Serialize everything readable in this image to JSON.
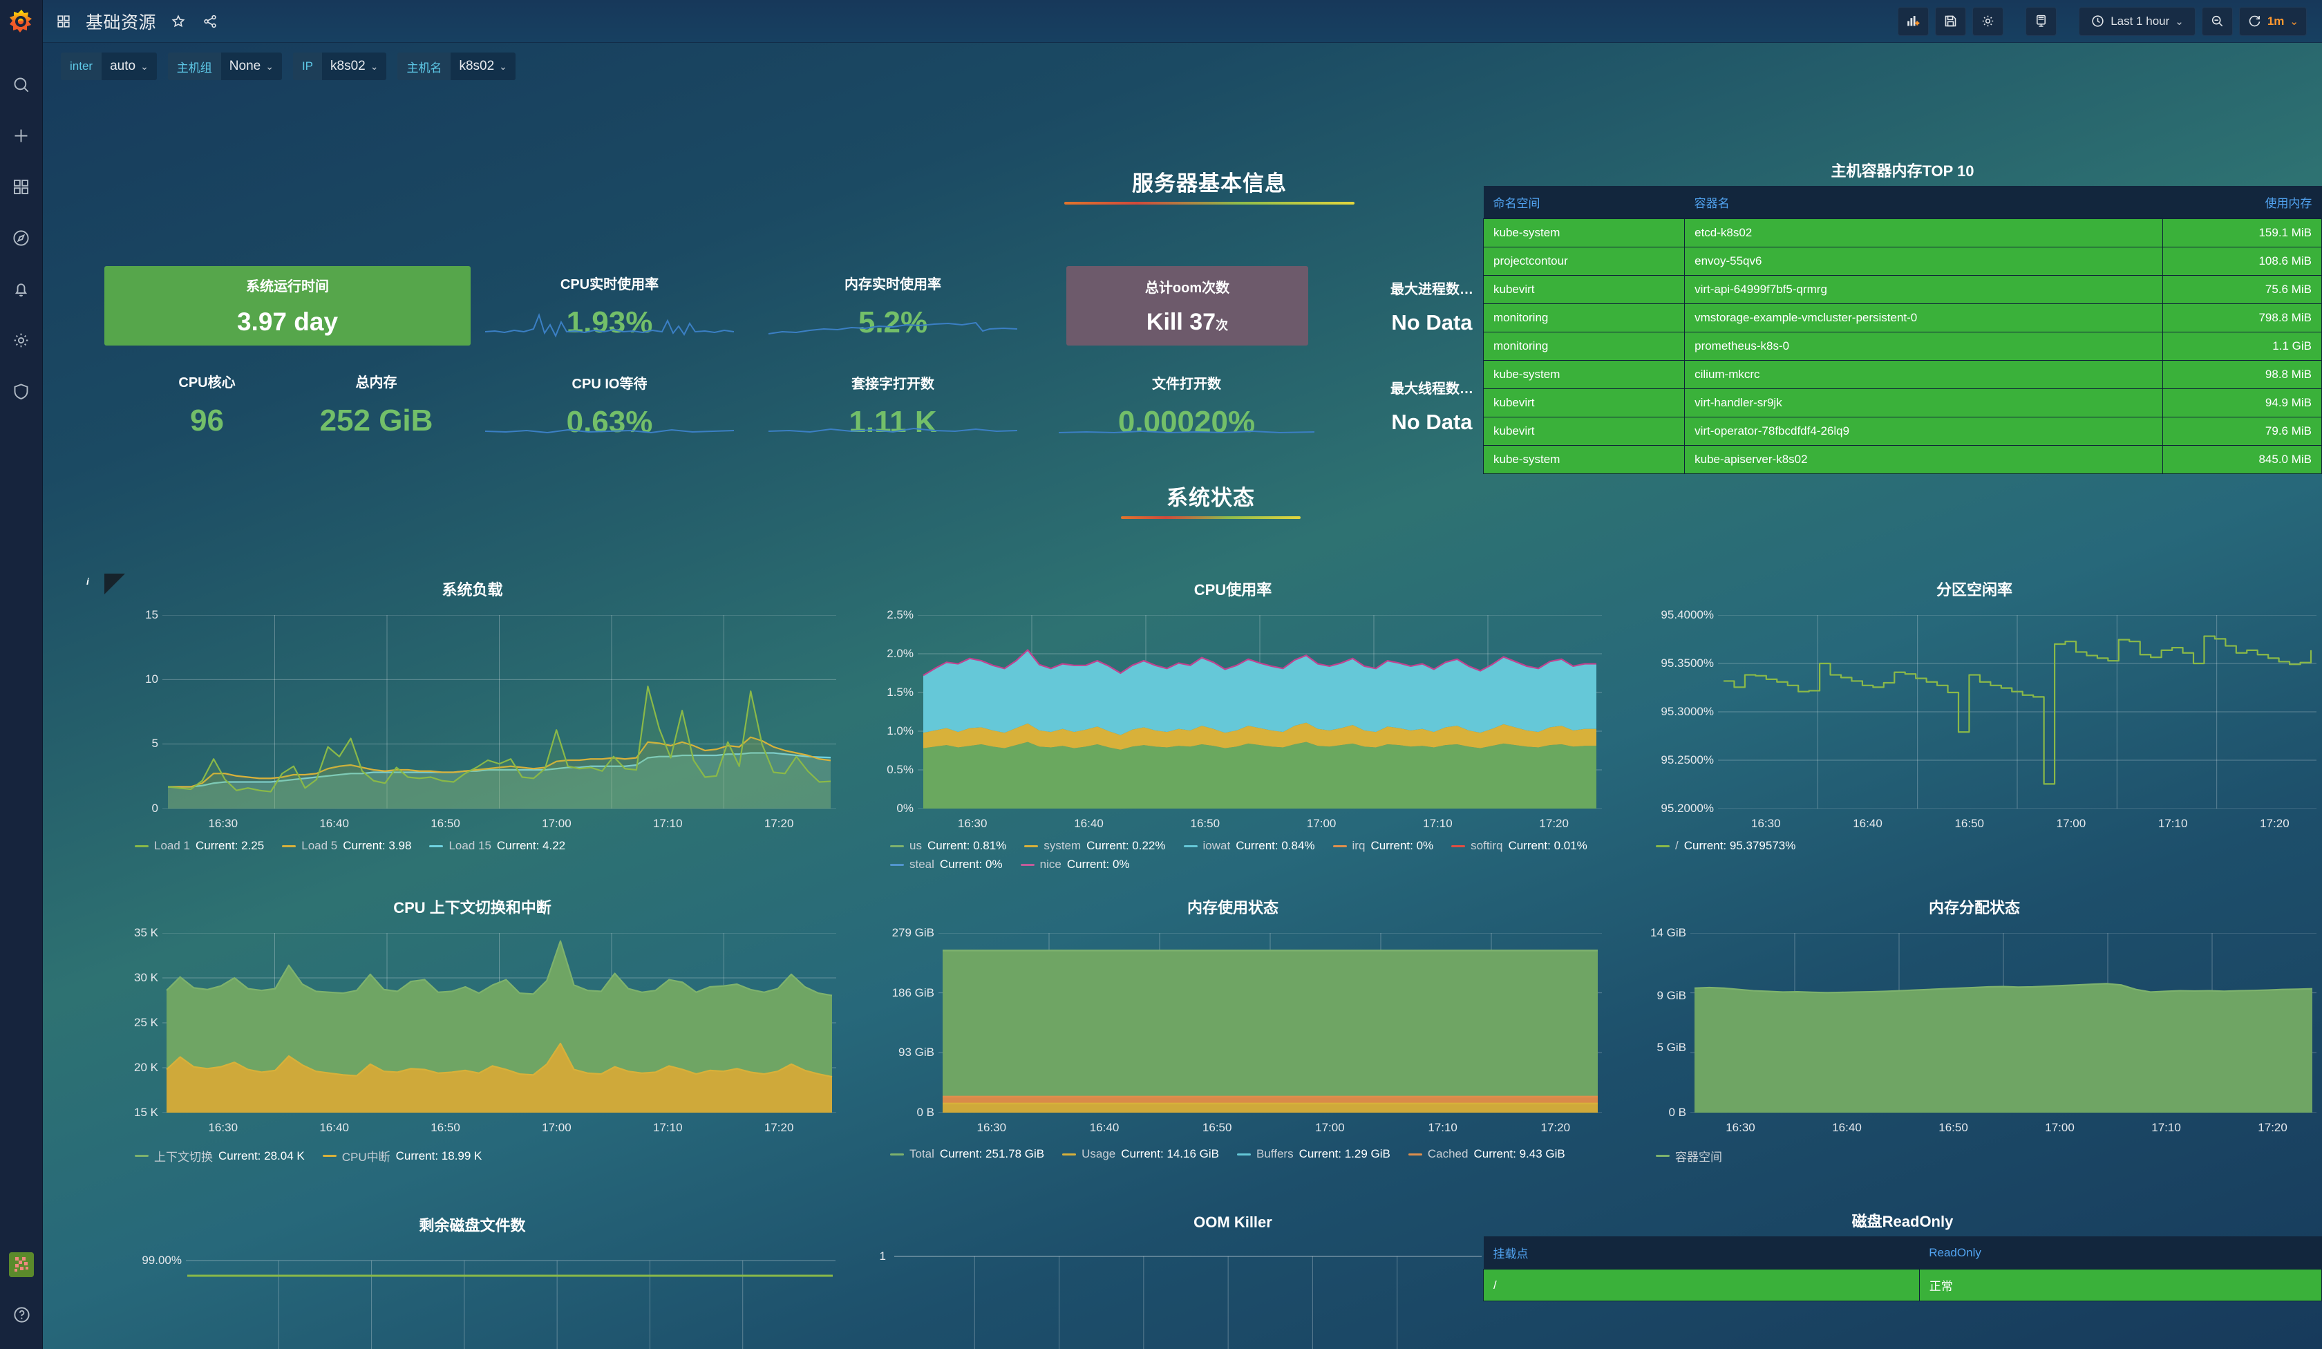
{
  "sidebar": {
    "logo": "grafana-logo",
    "items": [
      {
        "name": "search-icon",
        "label": "Search"
      },
      {
        "name": "create-icon",
        "label": "Create"
      },
      {
        "name": "dashboards-icon",
        "label": "Dashboards"
      },
      {
        "name": "explore-icon",
        "label": "Explore"
      },
      {
        "name": "alerting-icon",
        "label": "Alerting"
      },
      {
        "name": "configuration-icon",
        "label": "Configuration"
      },
      {
        "name": "shield-icon",
        "label": "Server Admin"
      }
    ],
    "bottom": [
      {
        "name": "avatar",
        "label": "User"
      },
      {
        "name": "help-icon",
        "label": "Help"
      }
    ]
  },
  "topnav": {
    "title": "基础资源",
    "dashboard_icon": "apps-icon",
    "star_icon": "star-icon",
    "share_icon": "share-icon",
    "buttons": [
      {
        "name": "add-panel-button",
        "icon": "add-panel-icon"
      },
      {
        "name": "save-dashboard-button",
        "icon": "save-icon"
      },
      {
        "name": "dashboard-settings-button",
        "icon": "gear-icon"
      },
      {
        "name": "tv-mode-button",
        "icon": "monitor-icon"
      }
    ],
    "time_range": "Last 1 hour",
    "time_icon": "clock-icon",
    "zoom_out_icon": "zoom-out-icon",
    "refresh_icon": "refresh-icon",
    "refresh_interval": "1m"
  },
  "variables": [
    {
      "label": "inter",
      "value": "auto"
    },
    {
      "label": "主机组",
      "value": "None"
    },
    {
      "label": "IP",
      "value": "k8s02"
    },
    {
      "label": "主机名",
      "value": "k8s02"
    }
  ],
  "sections": [
    {
      "title": "服务器基本信息"
    },
    {
      "title": "系统状态"
    }
  ],
  "stats": [
    {
      "title": "系统运行时间",
      "value": "3.97 day",
      "style": "green"
    },
    {
      "title": "CPU实时使用率",
      "value": "1.93%",
      "style": "plain"
    },
    {
      "title": "内存实时使用率",
      "value": "5.2%",
      "style": "plain"
    },
    {
      "title": "总计oom次数",
      "value": "Kill  37",
      "suffix": "次",
      "style": "purple"
    },
    {
      "title": "最大进程数…",
      "value": "No Data",
      "style": "nodata"
    },
    {
      "title": "CPU核心",
      "value": "96",
      "style": "plain"
    },
    {
      "title": "总内存",
      "value": "252 GiB",
      "style": "plain"
    },
    {
      "title": "CPU IO等待",
      "value": "0.63%",
      "style": "plain"
    },
    {
      "title": "套接字打开数",
      "value": "1.11 K",
      "style": "plain"
    },
    {
      "title": "文件打开数",
      "value": "0.00020%",
      "style": "plain"
    },
    {
      "title": "最大线程数…",
      "value": "No Data",
      "style": "nodata"
    }
  ],
  "top_table": {
    "title": "主机容器内存TOP 10",
    "columns": [
      "命名空间",
      "容器名",
      "使用内存"
    ],
    "rows": [
      [
        "kube-system",
        "etcd-k8s02",
        "159.1 MiB"
      ],
      [
        "projectcontour",
        "envoy-55qv6",
        "108.6 MiB"
      ],
      [
        "kubevirt",
        "virt-api-64999f7bf5-qrmrg",
        "75.6 MiB"
      ],
      [
        "monitoring",
        "vmstorage-example-vmcluster-persistent-0",
        "798.8 MiB"
      ],
      [
        "monitoring",
        "prometheus-k8s-0",
        "1.1 GiB"
      ],
      [
        "kube-system",
        "cilium-mkcrc",
        "98.8 MiB"
      ],
      [
        "kubevirt",
        "virt-handler-sr9jk",
        "94.9 MiB"
      ],
      [
        "kubevirt",
        "virt-operator-78fbcdfdf4-26lq9",
        "79.6 MiB"
      ],
      [
        "kube-system",
        "kube-apiserver-k8s02",
        "845.0 MiB"
      ]
    ]
  },
  "readonly_table": {
    "title": "磁盘ReadOnly",
    "columns": [
      "挂载点",
      "ReadOnly"
    ],
    "rows": [
      [
        "/",
        "正常"
      ]
    ]
  },
  "chart_data": [
    {
      "id": "system-load",
      "type": "line",
      "title": "系统负载",
      "xlabel": "",
      "ylabel": "",
      "ylim": [
        0,
        16
      ],
      "yticks": [
        "0",
        "5",
        "10",
        "15"
      ],
      "xticks": [
        "16:30",
        "16:40",
        "16:50",
        "17:00",
        "17:10",
        "17:20"
      ],
      "grid": true,
      "legend_position": "bottom",
      "series": [
        {
          "name": "Load 1",
          "current": "2.25",
          "color": "#8ab948",
          "values": [
            1.8,
            1.7,
            1.6,
            2.3,
            4.1,
            2.4,
            1.5,
            1.7,
            1.5,
            1.4,
            2.9,
            3.5,
            1.7,
            2.4,
            5.1,
            4.3,
            5.8,
            3.1,
            2.3,
            2.1,
            3.4,
            2.6,
            2.5,
            2.6,
            2.3,
            2.2,
            2.9,
            3.4,
            4.0,
            3.7,
            4.1,
            2.6,
            2.5,
            3.3,
            6.5,
            3.5,
            3.3,
            3.4,
            3.1,
            4.3,
            3.3,
            3.2,
            10.1,
            6.6,
            4.2,
            8.1,
            4.0,
            2.6,
            2.7,
            5.5,
            3.5,
            9.7,
            5.3,
            3.0,
            2.9,
            4.3,
            3.1,
            2.2,
            2.25
          ]
        },
        {
          "name": "Load 5",
          "current": "3.98",
          "color": "#d8b13a",
          "values": [
            1.8,
            1.8,
            1.8,
            2.1,
            2.9,
            2.9,
            2.7,
            2.6,
            2.5,
            2.5,
            2.6,
            2.8,
            2.8,
            2.9,
            3.3,
            3.5,
            3.6,
            3.4,
            3.2,
            3.1,
            3.2,
            3.2,
            3.1,
            3.1,
            3.0,
            3.0,
            3.1,
            3.2,
            3.3,
            3.4,
            3.5,
            3.4,
            3.3,
            3.4,
            3.9,
            4.0,
            4.0,
            4.1,
            4.1,
            4.2,
            4.1,
            4.2,
            5.5,
            5.4,
            5.2,
            5.5,
            5.2,
            4.8,
            4.9,
            5.2,
            5.1,
            5.9,
            5.6,
            5.1,
            4.8,
            4.6,
            4.4,
            4.1,
            3.98
          ]
        },
        {
          "name": "Load 15",
          "current": "4.22",
          "color": "#6fd2e0",
          "values": [
            1.8,
            1.8,
            1.8,
            1.9,
            2.1,
            2.2,
            2.2,
            2.2,
            2.2,
            2.2,
            2.3,
            2.4,
            2.5,
            2.6,
            2.7,
            2.8,
            2.9,
            2.9,
            3.0,
            3.0,
            3.0,
            3.0,
            3.0,
            3.0,
            3.0,
            3.0,
            3.1,
            3.1,
            3.2,
            3.2,
            3.2,
            3.2,
            3.2,
            3.2,
            3.3,
            3.4,
            3.4,
            3.5,
            3.5,
            3.5,
            3.5,
            3.6,
            4.2,
            4.3,
            4.3,
            4.4,
            4.4,
            4.4,
            4.4,
            4.5,
            4.5,
            4.6,
            4.6,
            4.6,
            4.5,
            4.4,
            4.3,
            4.25,
            4.22
          ]
        }
      ]
    },
    {
      "id": "cpu-usage",
      "type": "area",
      "title": "CPU使用率",
      "ylim": [
        0,
        2.5
      ],
      "yticks": [
        "0%",
        "0.5%",
        "1.0%",
        "1.5%",
        "2.0%",
        "2.5%"
      ],
      "xticks": [
        "16:30",
        "16:40",
        "16:50",
        "17:00",
        "17:10",
        "17:20"
      ],
      "grid": true,
      "legend_position": "bottom",
      "series": [
        {
          "name": "us",
          "current": "0.81%",
          "color": "#7eb26d",
          "values": [
            0.78,
            0.8,
            0.82,
            0.79,
            0.81,
            0.83,
            0.8,
            0.78,
            0.82,
            0.86,
            0.8,
            0.79,
            0.81,
            0.78,
            0.8,
            0.83,
            0.79,
            0.76,
            0.8,
            0.82,
            0.8,
            0.79,
            0.81,
            0.8,
            0.83,
            0.81,
            0.78,
            0.8,
            0.84,
            0.82,
            0.8,
            0.79,
            0.83,
            0.86,
            0.81,
            0.8,
            0.82,
            0.84,
            0.8,
            0.79,
            0.83,
            0.82,
            0.8,
            0.81,
            0.79,
            0.82,
            0.83,
            0.8,
            0.78,
            0.81,
            0.84,
            0.82,
            0.8,
            0.79,
            0.82,
            0.83,
            0.8,
            0.81,
            0.81
          ]
        },
        {
          "name": "system",
          "current": "0.22%",
          "color": "#d8b13a",
          "values": [
            0.2,
            0.21,
            0.22,
            0.2,
            0.23,
            0.22,
            0.21,
            0.2,
            0.22,
            0.24,
            0.21,
            0.2,
            0.22,
            0.21,
            0.22,
            0.23,
            0.21,
            0.19,
            0.22,
            0.23,
            0.21,
            0.2,
            0.22,
            0.21,
            0.24,
            0.22,
            0.2,
            0.21,
            0.23,
            0.22,
            0.21,
            0.2,
            0.24,
            0.25,
            0.22,
            0.21,
            0.22,
            0.24,
            0.21,
            0.2,
            0.23,
            0.22,
            0.21,
            0.22,
            0.2,
            0.23,
            0.24,
            0.21,
            0.2,
            0.22,
            0.25,
            0.23,
            0.21,
            0.2,
            0.23,
            0.24,
            0.21,
            0.22,
            0.22
          ]
        },
        {
          "name": "iowat",
          "current": "0.84%",
          "color": "#65c8d8",
          "values": [
            0.74,
            0.8,
            0.85,
            0.88,
            0.9,
            0.86,
            0.84,
            0.83,
            0.87,
            0.95,
            0.85,
            0.82,
            0.84,
            0.86,
            0.83,
            0.85,
            0.84,
            0.8,
            0.83,
            0.86,
            0.84,
            0.82,
            0.85,
            0.84,
            0.88,
            0.86,
            0.82,
            0.84,
            0.86,
            0.84,
            0.83,
            0.82,
            0.85,
            0.87,
            0.84,
            0.83,
            0.84,
            0.86,
            0.83,
            0.82,
            0.85,
            0.84,
            0.83,
            0.84,
            0.81,
            0.84,
            0.86,
            0.83,
            0.8,
            0.83,
            0.87,
            0.85,
            0.83,
            0.82,
            0.85,
            0.86,
            0.83,
            0.84,
            0.84
          ]
        },
        {
          "name": "irq",
          "current": "0%",
          "color": "#e08f4c",
          "values": [
            0
          ]
        },
        {
          "name": "softirq",
          "current": "0.01%",
          "color": "#e24d42",
          "values": [
            0.01
          ]
        },
        {
          "name": "steal",
          "current": "0%",
          "color": "#5195ce",
          "values": [
            0
          ]
        },
        {
          "name": "nice",
          "current": "0%",
          "color": "#c15c9a",
          "values": [
            0
          ]
        }
      ]
    },
    {
      "id": "partition-free",
      "type": "line",
      "title": "分区空闲率",
      "ylim": [
        95.2,
        95.42
      ],
      "yticks": [
        "95.2000%",
        "95.2500%",
        "95.3000%",
        "95.3500%",
        "95.4000%"
      ],
      "xticks": [
        "16:30",
        "16:40",
        "16:50",
        "17:00",
        "17:10",
        "17:20"
      ],
      "grid": true,
      "legend_position": "bottom",
      "series": [
        {
          "name": "/",
          "current": "95.379573%",
          "color": "#8ab948",
          "values": [
            95.345,
            95.338,
            95.352,
            95.351,
            95.347,
            95.344,
            95.34,
            95.333,
            95.334,
            95.365,
            95.352,
            95.349,
            95.345,
            95.34,
            95.338,
            95.343,
            95.355,
            95.353,
            95.348,
            95.344,
            95.34,
            95.332,
            95.287,
            95.352,
            95.344,
            95.34,
            95.337,
            95.333,
            95.329,
            95.327,
            95.228,
            95.387,
            95.39,
            95.378,
            95.374,
            95.371,
            95.368,
            95.392,
            95.39,
            95.375,
            95.372,
            95.38,
            95.383,
            95.377,
            95.365,
            95.396,
            95.393,
            95.385,
            95.377,
            95.38,
            95.375,
            95.371,
            95.367,
            95.364,
            95.366,
            95.38
          ]
        }
      ]
    },
    {
      "id": "cpu-ctxsw",
      "type": "area",
      "title": "CPU 上下文切换和中断",
      "ylim": [
        15000,
        35000
      ],
      "yticks": [
        "15 K",
        "20 K",
        "25 K",
        "30 K",
        "35 K"
      ],
      "xticks": [
        "16:30",
        "16:40",
        "16:50",
        "17:00",
        "17:10",
        "17:20"
      ],
      "grid": true,
      "legend_position": "bottom",
      "series": [
        {
          "name": "上下文切换",
          "current": "28.04 K",
          "color": "#7eb26d",
          "values": [
            28600,
            30100,
            28900,
            28700,
            29100,
            30000,
            28800,
            28600,
            28800,
            31400,
            29300,
            28500,
            28400,
            28300,
            28600,
            30400,
            28700,
            28500,
            29600,
            29800,
            28400,
            28500,
            29000,
            28300,
            29200,
            29800,
            28300,
            28200,
            29700,
            34100,
            29200,
            28600,
            28500,
            30500,
            28800,
            28400,
            28600,
            29800,
            29500,
            28400,
            29000,
            29100,
            29300,
            28700,
            28400,
            28800,
            30400,
            29000,
            28300,
            28040
          ]
        },
        {
          "name": "CPU中断",
          "current": "18.99 K",
          "color": "#d8b13a",
          "values": [
            19800,
            21200,
            20100,
            19900,
            20100,
            20600,
            19800,
            19500,
            19700,
            21300,
            20300,
            19600,
            19400,
            19200,
            19100,
            20400,
            19600,
            19500,
            19900,
            19800,
            19400,
            19500,
            19700,
            19400,
            20200,
            19800,
            19300,
            19200,
            20400,
            22700,
            19800,
            19400,
            19300,
            20100,
            19600,
            19400,
            19500,
            20200,
            19800,
            19300,
            19700,
            19600,
            19900,
            19500,
            19300,
            19600,
            20400,
            19700,
            19300,
            18990
          ]
        }
      ]
    },
    {
      "id": "mem-usage",
      "type": "area",
      "title": "内存使用状态",
      "ylim": [
        0,
        279
      ],
      "yticks": [
        "0 B",
        "93 GiB",
        "186 GiB",
        "279 GiB"
      ],
      "xticks": [
        "16:30",
        "16:40",
        "16:50",
        "17:00",
        "17:10",
        "17:20"
      ],
      "grid": true,
      "legend_position": "bottom",
      "series": [
        {
          "name": "Total",
          "current": "251.78 GiB",
          "color": "#7eb26d",
          "values": [
            251.78
          ]
        },
        {
          "name": "Usage",
          "current": "14.16 GiB",
          "color": "#d8b13a",
          "values": [
            14.16
          ]
        },
        {
          "name": "Buffers",
          "current": "1.29 GiB",
          "color": "#65c8d8",
          "values": [
            1.29
          ]
        },
        {
          "name": "Cached",
          "current": "9.43 GiB",
          "color": "#e08f4c",
          "values": [
            9.43
          ]
        }
      ]
    },
    {
      "id": "mem-alloc",
      "type": "area",
      "title": "内存分配状态",
      "ylim": [
        0,
        14
      ],
      "yticks": [
        "0 B",
        "5 GiB",
        "9 GiB",
        "14 GiB"
      ],
      "xticks": [
        "16:30",
        "16:40",
        "16:50",
        "17:00",
        "17:10",
        "17:20"
      ],
      "grid": true,
      "legend_position": "bottom",
      "series": [
        {
          "name": "容器空间",
          "current": "",
          "color": "#7eb26d",
          "values": [
            9.7,
            9.75,
            9.7,
            9.6,
            9.5,
            9.45,
            9.4,
            9.42,
            9.38,
            9.35,
            9.37,
            9.4,
            9.42,
            9.45,
            9.5,
            9.55,
            9.6,
            9.65,
            9.7,
            9.75,
            9.8,
            9.82,
            9.78,
            9.8,
            9.85,
            9.9,
            9.95,
            10.0,
            10.05,
            9.95,
            9.6,
            9.4,
            9.45,
            9.5,
            9.48,
            9.5,
            9.46,
            9.5,
            9.52,
            9.55,
            9.6,
            9.62,
            9.65
          ]
        }
      ]
    },
    {
      "id": "disk-inode-free",
      "type": "line",
      "title": "剩余磁盘文件数",
      "ylim": [
        0,
        100
      ],
      "yticks": [
        "99.00%"
      ],
      "xticks": [],
      "grid": true,
      "legend_position": "none",
      "series": [
        {
          "name": "/",
          "current": "",
          "color": "#8ab948",
          "values": [
            98.3,
            98.3
          ]
        }
      ]
    },
    {
      "id": "oom-killer",
      "type": "line",
      "title": "OOM Killer",
      "ylim": [
        0,
        1
      ],
      "yticks": [
        "1"
      ],
      "xticks": [],
      "grid": true,
      "legend_position": "none",
      "series": []
    }
  ]
}
